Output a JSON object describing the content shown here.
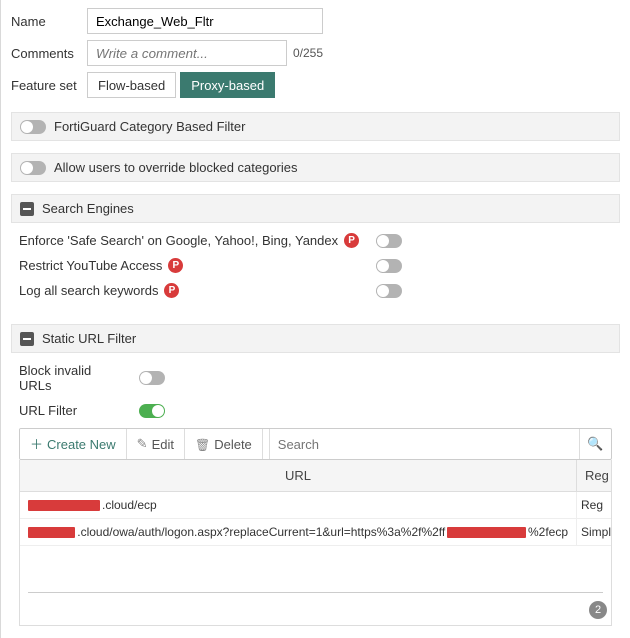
{
  "form": {
    "name_label": "Name",
    "name_value": "Exchange_Web_Fltr",
    "comments_label": "Comments",
    "comments_placeholder": "Write a comment...",
    "comments_count": "0/255",
    "feature_set_label": "Feature set",
    "feature_flow": "Flow-based",
    "feature_proxy": "Proxy-based"
  },
  "sections": {
    "fortiguard": "FortiGuard Category Based Filter",
    "override": "Allow users to override blocked categories",
    "search_engines": "Search Engines",
    "static_url": "Static URL Filter"
  },
  "search_opts": {
    "safe_search": "Enforce 'Safe Search' on Google, Yahoo!, Bing, Yandex",
    "youtube": "Restrict YouTube Access",
    "log_keywords": "Log all search keywords",
    "badge": "P"
  },
  "static": {
    "block_invalid": "Block invalid URLs",
    "url_filter": "URL Filter"
  },
  "toolbar": {
    "create": "Create New",
    "edit": "Edit",
    "delete": "Delete",
    "search_placeholder": "Search"
  },
  "table": {
    "col_url": "URL",
    "col_type_0": "Reg",
    "col_type_1": "Simple",
    "row0_suffix": ".cloud/ecp",
    "row1_mid": ".cloud/owa/auth/logon.aspx?replaceCurrent=1&url=https%3a%2f%2ff",
    "row1_suffix": "%2fecp"
  },
  "pager": "2"
}
